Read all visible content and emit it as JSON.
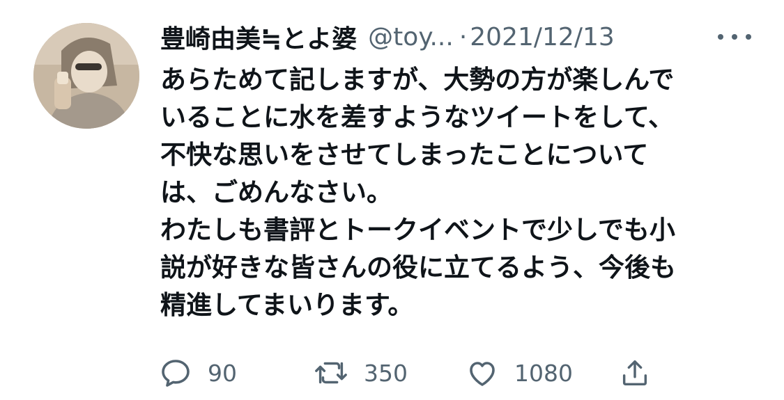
{
  "tweet": {
    "display_name": "豊崎由美≒とよ婆",
    "handle": "@toy...",
    "separator": "·",
    "date": "2021/12/13",
    "body_lines": [
      "あらためて記しますが、大勢の方が楽しんで",
      "いることに水を差すようなツイートをして、",
      "不快な思いをさせてしまったことについて",
      "は、ごめんなさい。",
      "わたしも書評とトークイベントで少しでも小",
      "説が好きな皆さんの役に立てるよう、今後も",
      "精進してまいります。"
    ],
    "more_icon": "more-horizontal-icon",
    "actions": {
      "reply": {
        "icon": "reply-icon",
        "count": "90"
      },
      "retweet": {
        "icon": "retweet-icon",
        "count": "350"
      },
      "like": {
        "icon": "heart-icon",
        "count": "1080"
      },
      "share": {
        "icon": "share-icon"
      }
    }
  },
  "colors": {
    "text_primary": "#0f1419",
    "text_secondary": "#536471",
    "background": "#ffffff"
  }
}
